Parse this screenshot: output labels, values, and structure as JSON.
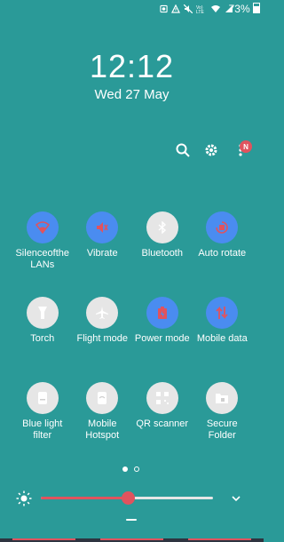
{
  "status_bar": {
    "icons": [
      "alarm-icon",
      "warning-icon",
      "mute-icon",
      "volte-icon",
      "wifi-icon",
      "signal-icon"
    ],
    "battery": "73%"
  },
  "clock": {
    "time": "12:12",
    "date": "Wed 27 May"
  },
  "header": {
    "icons": [
      "search-icon",
      "settings-icon",
      "more-icon"
    ],
    "notification_badge": "N"
  },
  "tiles": [
    {
      "label": "Silenceofthe LANs",
      "icon": "wifi-icon",
      "state": "on"
    },
    {
      "label": "Vibrate",
      "icon": "vibrate-icon",
      "state": "on"
    },
    {
      "label": "Bluetooth",
      "icon": "bluetooth-icon",
      "state": "off"
    },
    {
      "label": "Auto rotate",
      "icon": "auto-rotate-icon",
      "state": "on"
    },
    {
      "label": "Torch",
      "icon": "torch-icon",
      "state": "off"
    },
    {
      "label": "Flight mode",
      "icon": "flight-icon",
      "state": "off"
    },
    {
      "label": "Power mode",
      "icon": "power-mode-icon",
      "state": "on"
    },
    {
      "label": "Mobile data",
      "icon": "mobile-data-icon",
      "state": "on"
    },
    {
      "label": "Blue light filter",
      "icon": "blue-light-icon",
      "state": "off"
    },
    {
      "label": "Mobile Hotspot",
      "icon": "hotspot-icon",
      "state": "off"
    },
    {
      "label": "QR scanner",
      "icon": "qr-icon",
      "state": "off"
    },
    {
      "label": "Secure Folder",
      "icon": "secure-folder-icon",
      "state": "off"
    }
  ],
  "pager": {
    "pages": 2,
    "current": 1
  },
  "brightness": {
    "level": 0.51
  },
  "colors": {
    "background": "#2a9a98",
    "accent_on": "#4a8cf0",
    "tile_off": "#e6e6e6",
    "active_red": "#e0535e"
  }
}
